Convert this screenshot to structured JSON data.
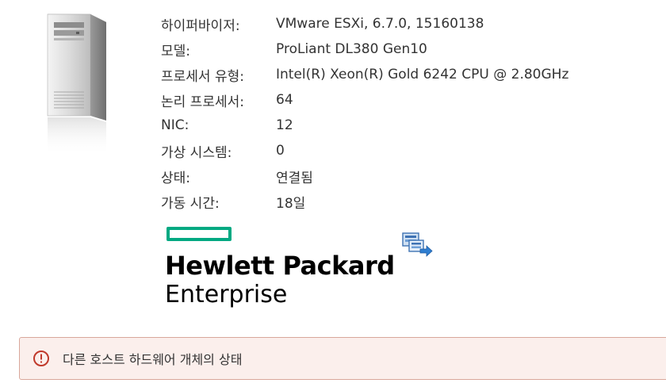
{
  "host_info": {
    "rows": [
      {
        "label": "하이퍼바이저:",
        "value": "VMware ESXi, 6.7.0, 15160138"
      },
      {
        "label": "모델:",
        "value": "ProLiant DL380 Gen10"
      },
      {
        "label": "프로세서 유형:",
        "value": "Intel(R) Xeon(R) Gold 6242 CPU @ 2.80GHz"
      },
      {
        "label": "논리 프로세서:",
        "value": "64"
      },
      {
        "label": "NIC:",
        "value": "12"
      },
      {
        "label": "가상 시스템:",
        "value": "0"
      },
      {
        "label": "상태:",
        "value": "연결됨"
      },
      {
        "label": "가동 시간:",
        "value": "18일"
      }
    ]
  },
  "vendor_logo": {
    "line1": "Hewlett Packard",
    "line2": "Enterprise",
    "accent_color": "#01a982"
  },
  "icons": {
    "server": "server-tower-icon",
    "action": "host-migrate-icon",
    "alert": "alert-circle-icon"
  },
  "alert": {
    "text": "다른 호스트 하드웨어 개체의 상태",
    "color": "#c0392b",
    "background": "#fbefec"
  }
}
